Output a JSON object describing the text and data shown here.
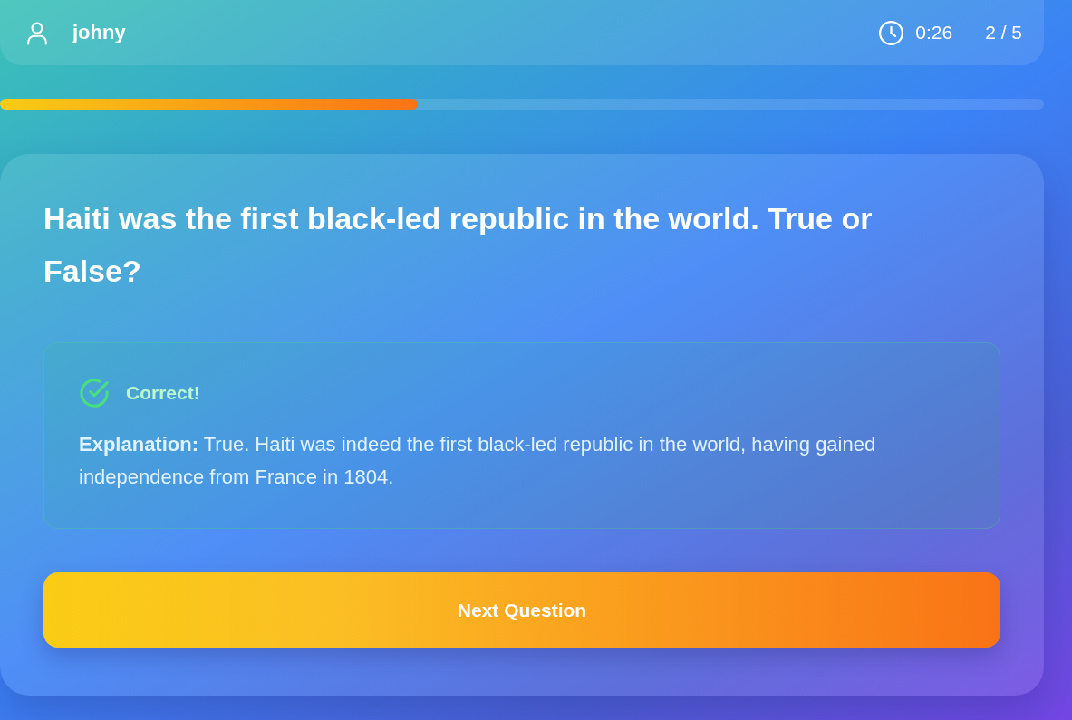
{
  "header": {
    "username": "johny",
    "timer": "0:26",
    "counter": "2 / 5"
  },
  "progress": {
    "level": 0.4
  },
  "question": {
    "text": "Haiti was the first black-led republic in the world. True or False?"
  },
  "feedback": {
    "correct": true,
    "status": "Correct!",
    "explanation": "**Explanation:** True. Haiti was indeed the first black-led republic in the world, having gained independence from France in 1804."
  },
  "next_button": {
    "label": "Next Question"
  }
}
